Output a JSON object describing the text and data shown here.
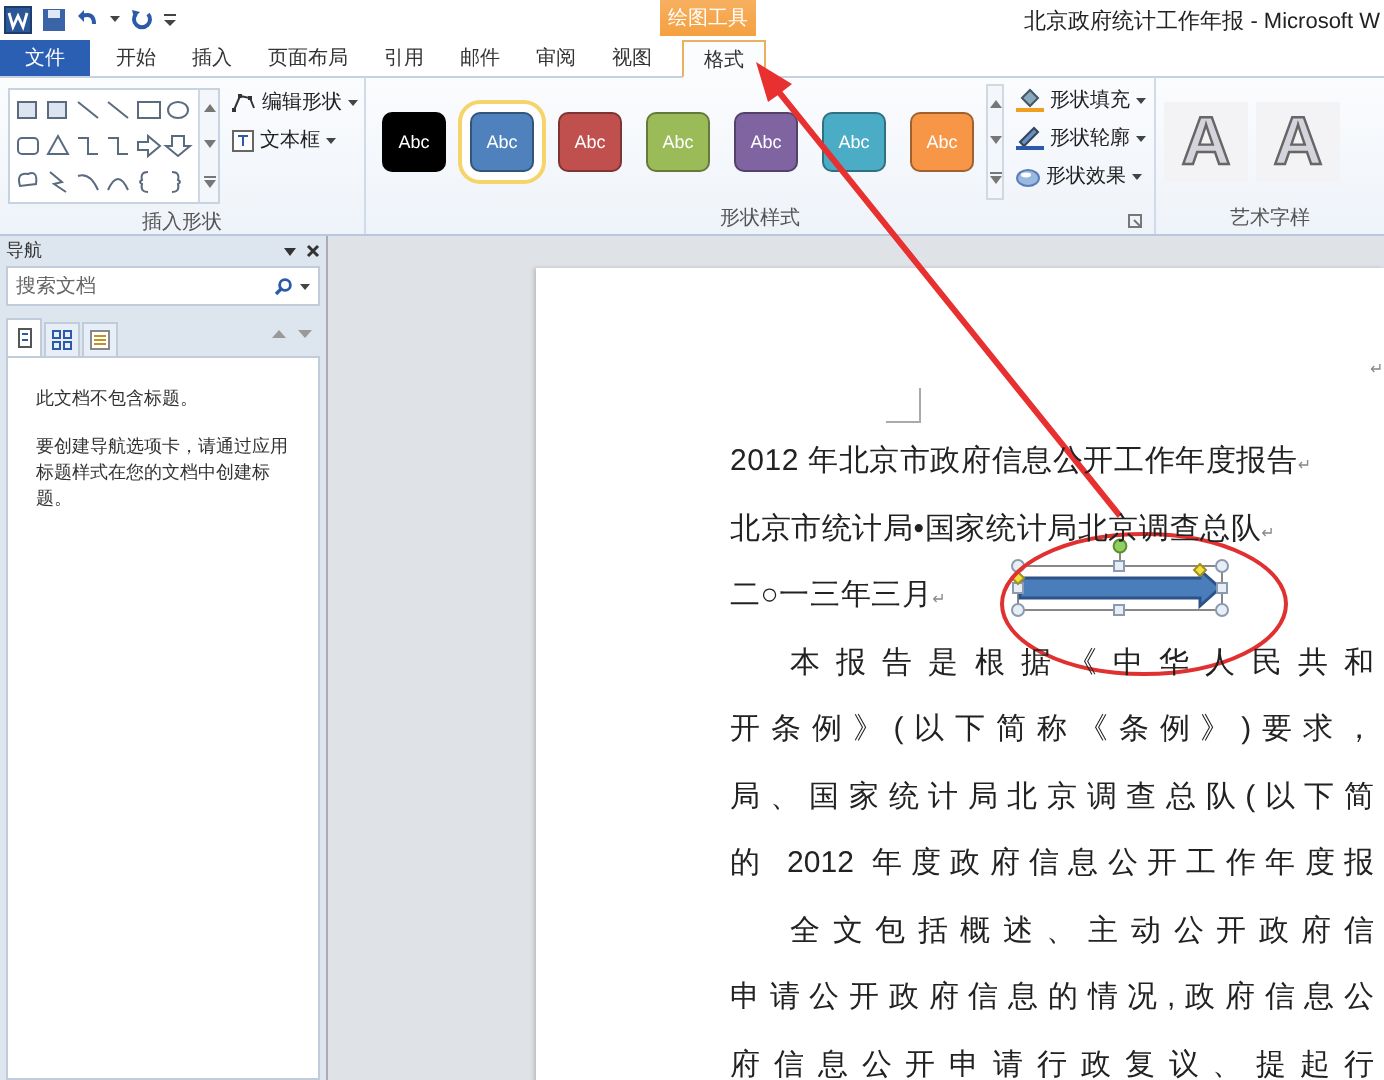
{
  "window": {
    "title": "北京政府统计工作年报 - Microsoft W",
    "context_group": "绘图工具"
  },
  "ribbon_tabs": [
    {
      "label": "文件",
      "kind": "file",
      "selected": false
    },
    {
      "label": "开始",
      "kind": "tab",
      "selected": false
    },
    {
      "label": "插入",
      "kind": "tab",
      "selected": false
    },
    {
      "label": "页面布局",
      "kind": "tab",
      "selected": false
    },
    {
      "label": "引用",
      "kind": "tab",
      "selected": false
    },
    {
      "label": "邮件",
      "kind": "tab",
      "selected": false
    },
    {
      "label": "审阅",
      "kind": "tab",
      "selected": false
    },
    {
      "label": "视图",
      "kind": "tab",
      "selected": false
    },
    {
      "label": "格式",
      "kind": "context",
      "selected": true
    }
  ],
  "insert_shapes": {
    "label": "插入形状",
    "buttons": [
      "编辑形状",
      "文本框"
    ]
  },
  "shape_styles": {
    "label": "形状样式",
    "swatches": [
      {
        "text": "Abc",
        "color": "#000000",
        "selected": false
      },
      {
        "text": "Abc",
        "color": "#4f81bd",
        "selected": true
      },
      {
        "text": "Abc",
        "color": "#c0504d",
        "selected": false
      },
      {
        "text": "Abc",
        "color": "#9bbb59",
        "selected": false
      },
      {
        "text": "Abc",
        "color": "#8064a2",
        "selected": false
      },
      {
        "text": "Abc",
        "color": "#4bacc6",
        "selected": false
      },
      {
        "text": "Abc",
        "color": "#f79646",
        "selected": false
      }
    ],
    "commands": [
      {
        "label": "形状填充",
        "kind": "fill"
      },
      {
        "label": "形状轮廓",
        "kind": "outline"
      },
      {
        "label": "形状效果",
        "kind": "effects"
      }
    ]
  },
  "wordart_styles": {
    "label": "艺术字样",
    "samples": [
      "A",
      "A"
    ]
  },
  "navigation": {
    "title": "导航",
    "search": {
      "placeholder": "搜索文档"
    },
    "tabs": [
      {
        "kind": "headings",
        "selected": true
      },
      {
        "kind": "pages",
        "selected": false
      },
      {
        "kind": "results",
        "selected": false
      }
    ],
    "messages": [
      "此文档不包含标题。",
      "要创建导航选项卡，请通过应用标题样式在您的文档中创建标题。"
    ]
  },
  "document": {
    "empty_mark": "↵",
    "lines": [
      {
        "text": "2012 年北京市政府信息公开工作年度报告",
        "kind": "heading",
        "mark": "↵"
      },
      {
        "text": "北京市统计局•国家统计局北京调查总队",
        "kind": "heading",
        "mark": "↵"
      },
      {
        "text": "二○一三年三月",
        "kind": "heading",
        "mark": "↵"
      },
      {
        "text": "本报告是根据《中华人民共和",
        "kind": "indent"
      },
      {
        "text": "开条例》(以下简称《条例》)要求，",
        "kind": "body"
      },
      {
        "text": "局、国家统计局北京调查总队(以下简",
        "kind": "body"
      },
      {
        "text": "的 2012 年度政府信息公开工作年度报",
        "kind": "body"
      },
      {
        "text": "全文包括概述、主动公开政府信",
        "kind": "indent"
      },
      {
        "text": "申请公开政府信息的情况,政府信息公",
        "kind": "body"
      },
      {
        "text": "府信息公开申请行政复议、提起行",
        "kind": "body"
      }
    ]
  }
}
